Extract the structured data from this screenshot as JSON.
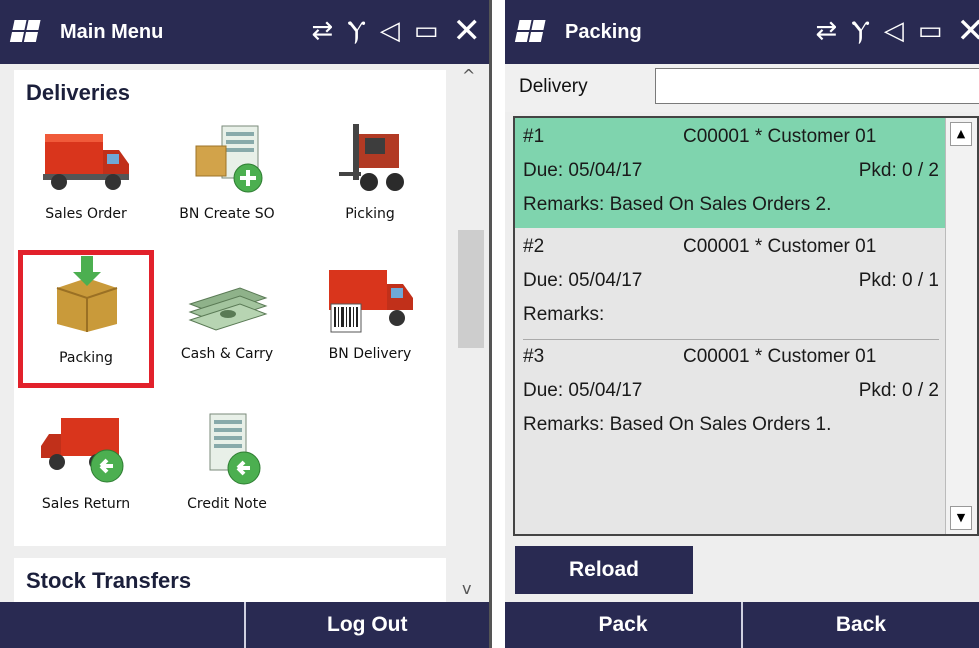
{
  "left": {
    "title": "Main Menu",
    "deliveries_title": "Deliveries",
    "tiles": [
      {
        "label": "Sales Order",
        "icon": "truck-icon"
      },
      {
        "label": "BN Create SO",
        "icon": "invoice-add-icon"
      },
      {
        "label": "Picking",
        "icon": "forklift-icon"
      },
      {
        "label": "Packing",
        "icon": "box-arrow-icon"
      },
      {
        "label": "Cash & Carry",
        "icon": "money-icon"
      },
      {
        "label": "BN Delivery",
        "icon": "truck-barcode-icon"
      },
      {
        "label": "Sales Return",
        "icon": "truck-return-icon"
      },
      {
        "label": "Credit Note",
        "icon": "invoice-return-icon"
      }
    ],
    "stock_title": "Stock Transfers",
    "bottom_left": "",
    "bottom_right": "Log Out"
  },
  "right": {
    "title": "Packing",
    "delivery_label": "Delivery",
    "delivery_value": "",
    "items": [
      {
        "num": "#1",
        "customer": "C00001 * Customer 01",
        "due": "Due: 05/04/17",
        "pkd": "Pkd: 0 / 2",
        "remarks": "Remarks: Based On Sales Orders 2."
      },
      {
        "num": "#2",
        "customer": "C00001 * Customer 01",
        "due": "Due: 05/04/17",
        "pkd": "Pkd: 0 / 1",
        "remarks": "Remarks:"
      },
      {
        "num": "#3",
        "customer": "C00001 * Customer 01",
        "due": "Due: 05/04/17",
        "pkd": "Pkd: 0 / 2",
        "remarks": "Remarks: Based On Sales Orders 1."
      }
    ],
    "reload_label": "Reload",
    "pack_label": "Pack",
    "back_label": "Back"
  },
  "colors": {
    "titlebar": "#292a52",
    "selected_row": "#7fd4ae",
    "highlight": "#e2212b"
  }
}
